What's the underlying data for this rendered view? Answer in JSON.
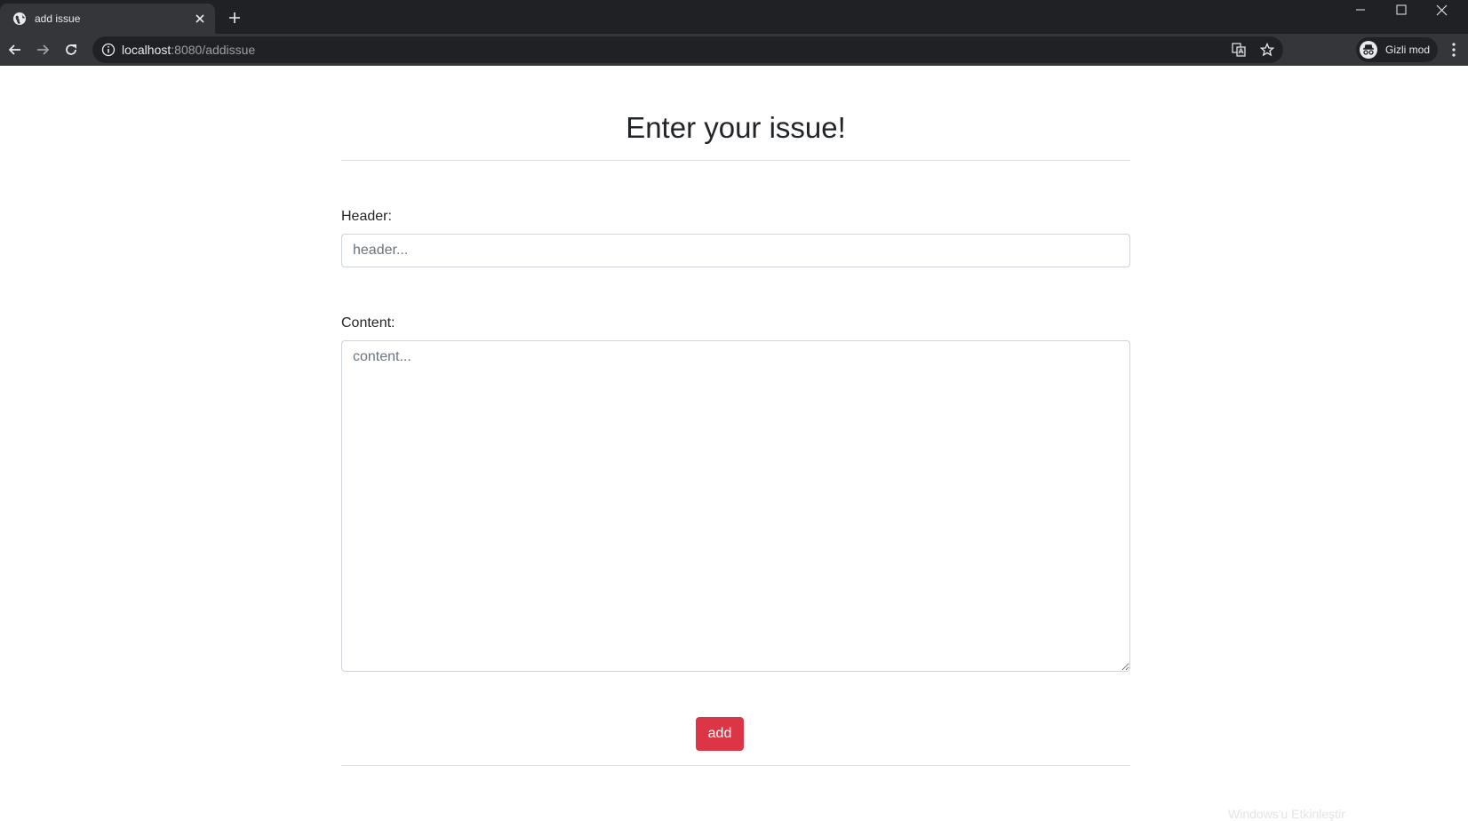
{
  "browser": {
    "tab_title": "add issue",
    "url_host": "localhost",
    "url_path": ":8080/addissue",
    "profile_label": "Gizli mod",
    "icons": [
      "globe-icon",
      "close-icon",
      "plus-icon",
      "back-icon",
      "forward-icon",
      "reload-icon",
      "info-icon",
      "translate-icon",
      "star-icon",
      "incognito-icon",
      "more-icon",
      "minimize-icon",
      "maximize-icon",
      "window-close-icon"
    ]
  },
  "page": {
    "title": "Enter your issue!",
    "form": {
      "header_label": "Header:",
      "header_placeholder": "header...",
      "header_value": "",
      "content_label": "Content:",
      "content_placeholder": "content...",
      "content_value": "",
      "submit_label": "add"
    },
    "footer_faint_text": "Windows'u Etkinleştir"
  },
  "colors": {
    "accent_button": "#dc3545",
    "title_text": "#212529",
    "chrome_dark": "#202124",
    "chrome_toolbar": "#35363a"
  }
}
